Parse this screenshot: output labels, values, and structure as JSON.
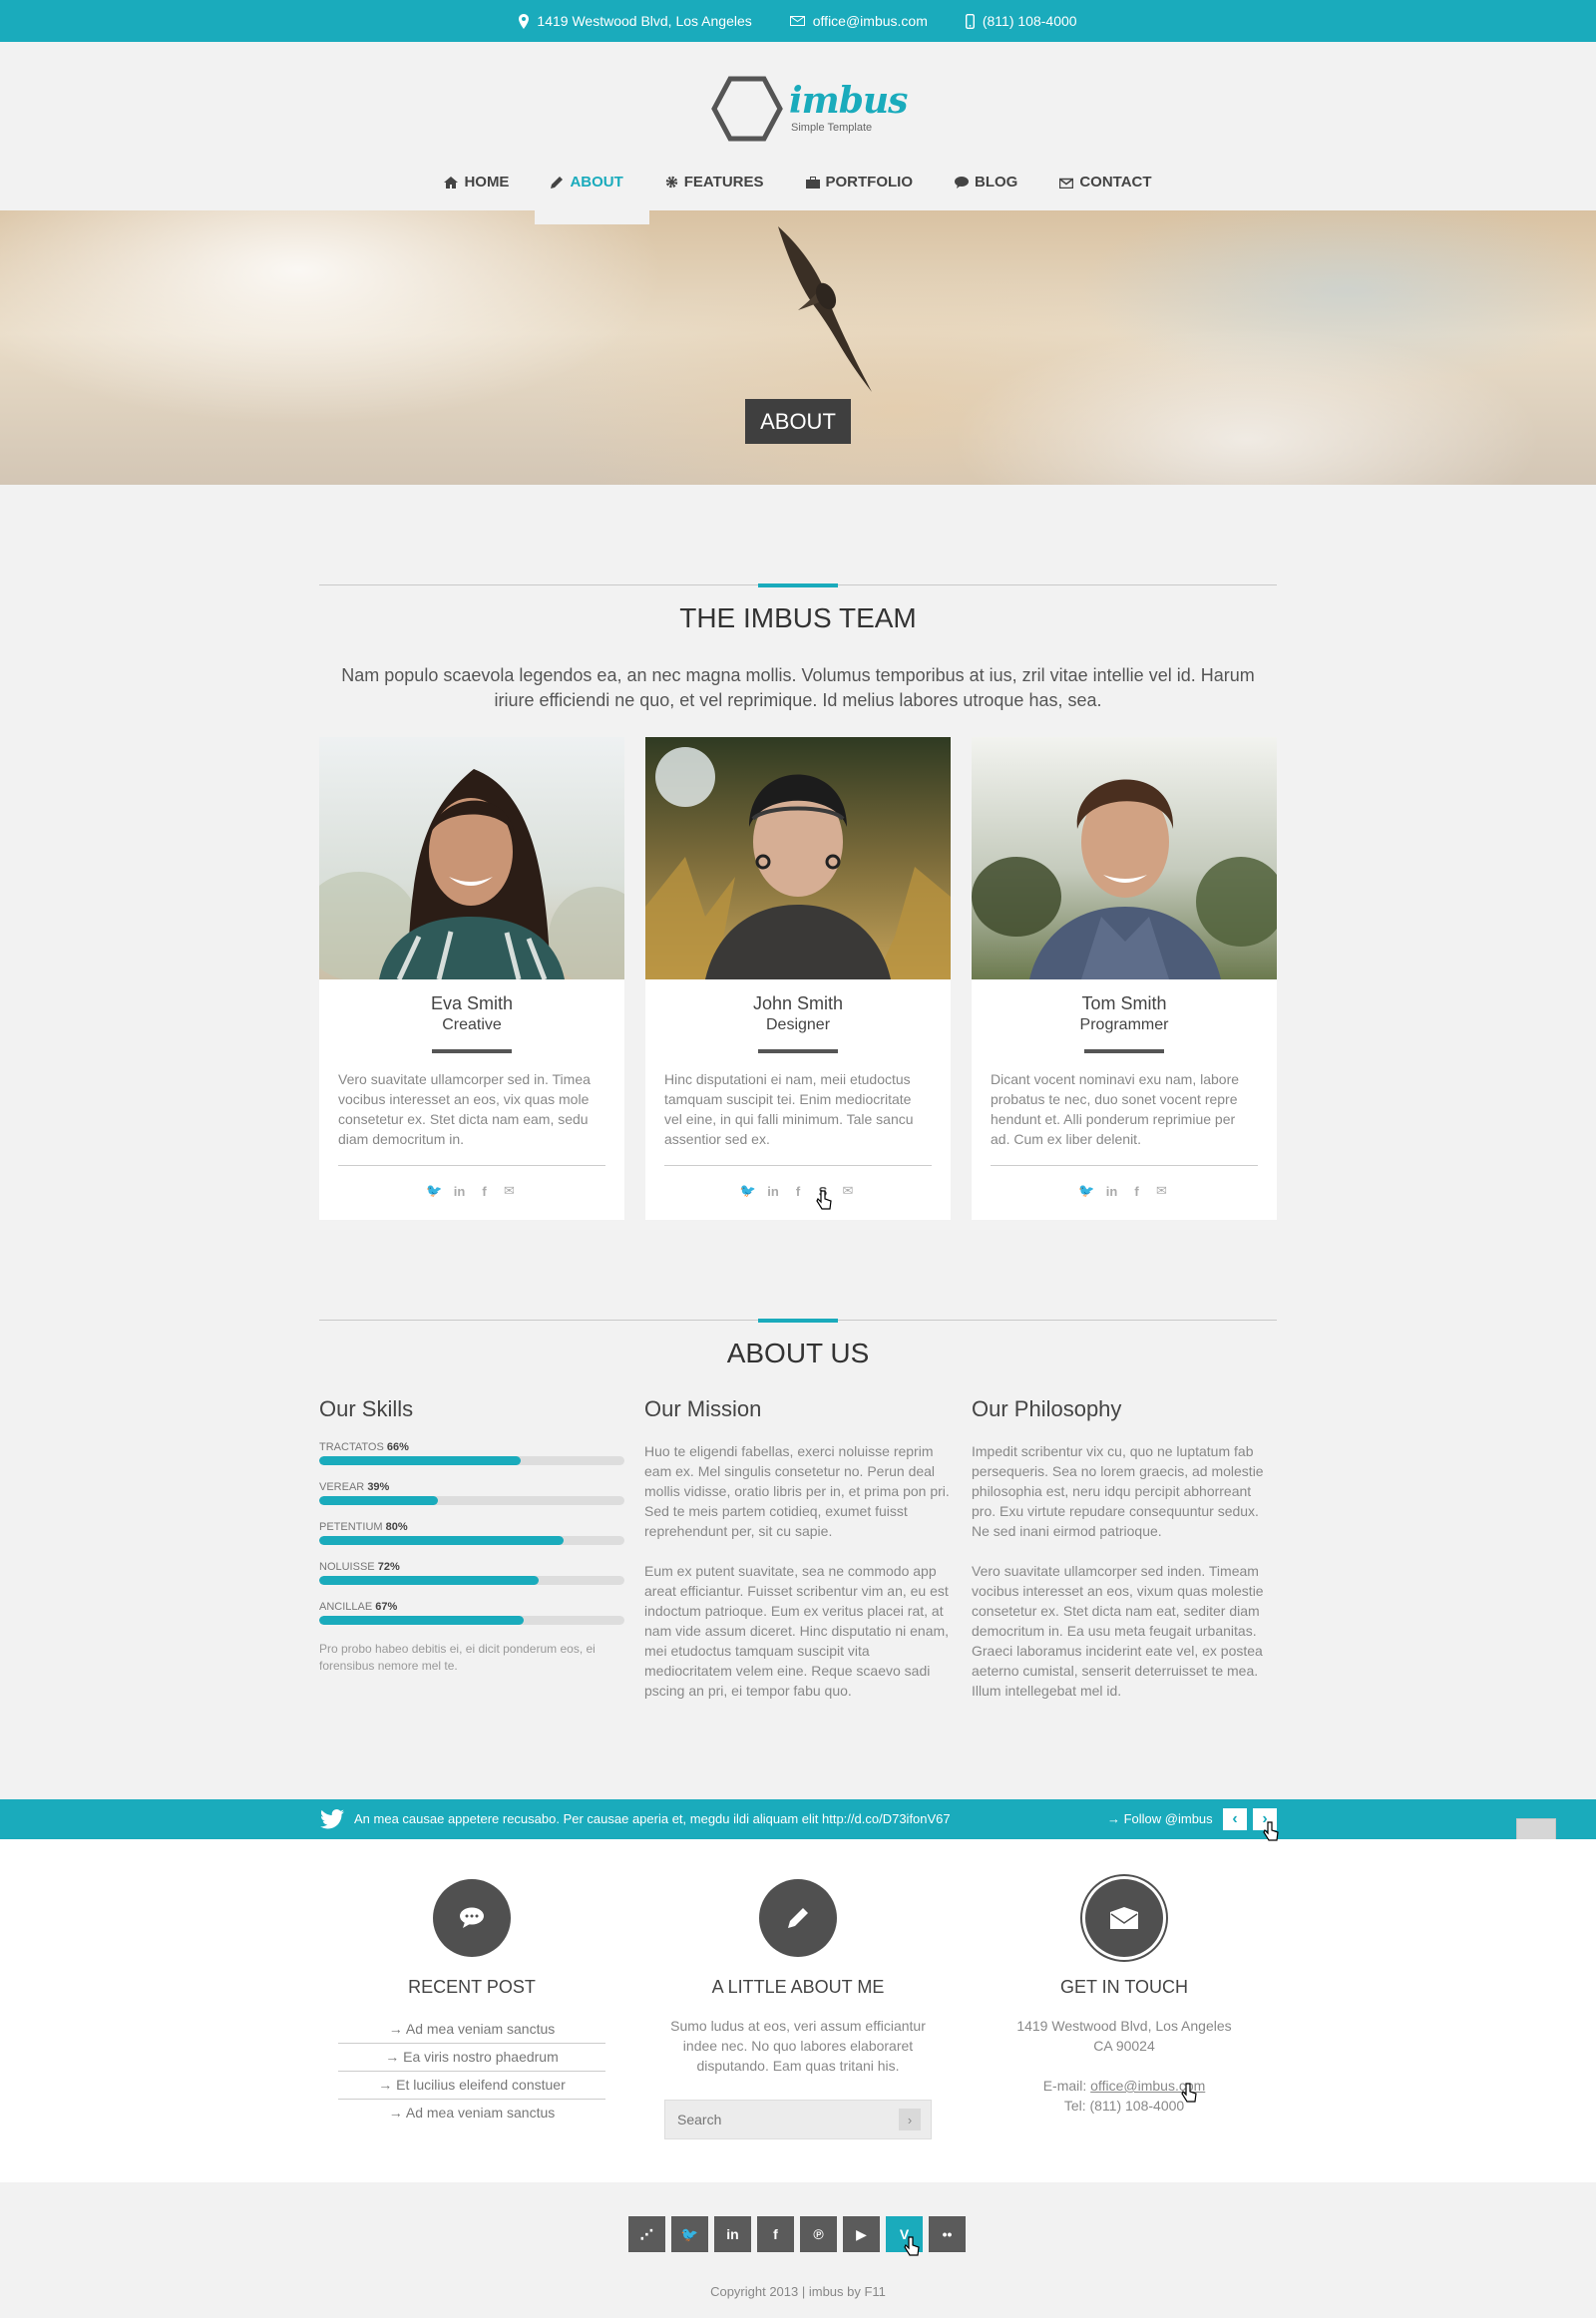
{
  "topbar": {
    "address": "1419 Westwood Blvd, Los Angeles",
    "email": "office@imbus.com",
    "phone": "(811) 108-4000"
  },
  "logo": {
    "name_part1": "im",
    "name_part2": "bus",
    "tagline": "Simple Template"
  },
  "nav": [
    {
      "label": "HOME",
      "icon": "home-icon"
    },
    {
      "label": "ABOUT",
      "icon": "pencil-icon",
      "active": true
    },
    {
      "label": "FEATURES",
      "icon": "gear-icon"
    },
    {
      "label": "PORTFOLIO",
      "icon": "briefcase-icon"
    },
    {
      "label": "BLOG",
      "icon": "chat-icon"
    },
    {
      "label": "CONTACT",
      "icon": "mail-icon"
    }
  ],
  "hero": {
    "title": "ABOUT"
  },
  "team": {
    "title": "THE IMBUS TEAM",
    "intro": "Nam populo scaevola legendos ea, an nec magna mollis. Volumus temporibus at ius, zril vitae intellie vel id. Harum iriure efficiendi ne quo, et vel reprimique. Id melius labores utroque has, sea.",
    "members": [
      {
        "name": "Eva Smith",
        "role": "Creative",
        "description": "Vero suavitate ullamcorper sed in. Timea vocibus interesset an eos, vix quas mole consetetur ex. Stet dicta nam eam, sedu diam democritum in."
      },
      {
        "name": "John Smith",
        "role": "Designer",
        "description": "Hinc disputationi ei nam, meii etudoctus tamquam suscipit tei. Enim mediocritate vel eine, in qui falli minimum. Tale sancu assentior sed ex."
      },
      {
        "name": "Tom Smith",
        "role": "Programmer",
        "description": "Dicant vocent nominavi exu nam, labore probatus te nec, duo sonet vocent repre hendunt et. Alli ponderum reprimiue per ad. Cum ex liber delenit."
      }
    ]
  },
  "about": {
    "title": "ABOUT US",
    "skills": {
      "heading": "Our Skills",
      "items": [
        {
          "label": "TRACTATOS",
          "percent_text": "66%",
          "percent": 66
        },
        {
          "label": "VEREAR",
          "percent_text": "39%",
          "percent": 39
        },
        {
          "label": "PETENTIUM",
          "percent_text": "80%",
          "percent": 80
        },
        {
          "label": "NOLUISSE",
          "percent_text": "72%",
          "percent": 72
        },
        {
          "label": "ANCILLAE",
          "percent_text": "67%",
          "percent": 67
        }
      ],
      "note": "Pro probo habeo debitis ei, ei dicit ponderum eos, ei forensibus nemore mel te."
    },
    "mission": {
      "heading": "Our Mission",
      "p1": "Huo te eligendi fabellas, exerci noluisse reprim eam ex. Mel singulis consetetur no. Perun deal mollis vidisse, oratio libris per in, et prima pon pri. Sed te meis partem cotidieq, exumet fuisst reprehendunt per, sit cu sapie.",
      "p2": "Eum ex putent suavitate, sea ne commodo app areat efficiantur. Fuisset scribentur vim an, eu est indoctum patrioque. Eum ex veritus placei rat, at nam vide assum diceret. Hinc disputatio ni enam, mei etudoctus tamquam suscipit vita mediocritatem velem eine.  Reque scaevo sadi pscing an pri, ei tempor fabu quo."
    },
    "philosophy": {
      "heading": "Our Philosophy",
      "p1": "Impedit scribentur vix cu, quo ne luptatum fab persequeris. Sea no lorem graecis, ad molestie philosophia est, neru idqu percipit abhorreant pro. Exu virtute repudare consequuntur sedux. Ne sed inani eirmod patrioque.",
      "p2": "Vero suavitate ullamcorper sed inden. Timeam vocibus interesset an eos, vixum quas molestie consetetur ex. Stet dicta nam eat, sediter diam democritum in. Ea usu meta feugait urbanitas. Graeci laboramus inciderint eate vel, ex postea aeterno cumistal, senserit deterruisset te mea. Illum intellegebat mel id."
    }
  },
  "twitter_bar": {
    "tweet": "An mea causae appetere recusabo. Per causae aperia et, megdu ildi aliquam elit http://d.co/D73ifonV67",
    "follow": "→ Follow @imbus",
    "prev": "‹",
    "next": "›"
  },
  "back_to_top": "︿",
  "footer": {
    "recent": {
      "title": "RECENT POST",
      "items": [
        "→ Ad mea veniam sanctus",
        "→ Ea viris nostro phaedrum",
        "→ Et lucilius eleifend constuer",
        "→ Ad mea veniam sanctus"
      ]
    },
    "about_me": {
      "title": "A LITTLE ABOUT ME",
      "text": "Sumo ludus at eos, veri assum efficiantur indee nec. No quo labores elaboraret disputando. Eam quas tritani his.",
      "search_placeholder": "Search",
      "search_button": "›"
    },
    "contact": {
      "title": "GET IN TOUCH",
      "address1": "1419 Westwood Blvd, Los Angeles",
      "address2": "CA 90024",
      "email_label": "E-mail:",
      "email": "office@imbus.com",
      "tel": "Tel: (811) 108-4000"
    }
  },
  "social_icons": [
    {
      "name": "rss-icon",
      "glyph": "⋰"
    },
    {
      "name": "twitter-icon",
      "glyph": "🐦"
    },
    {
      "name": "linkedin-icon",
      "glyph": "in"
    },
    {
      "name": "facebook-icon",
      "glyph": "f"
    },
    {
      "name": "pinterest-icon",
      "glyph": "℗"
    },
    {
      "name": "youtube-icon",
      "glyph": "▶"
    },
    {
      "name": "vimeo-icon",
      "glyph": "V",
      "active": true
    },
    {
      "name": "flickr-icon",
      "glyph": "••"
    }
  ],
  "copyright": "Copyright 2013 | imbus by F11",
  "colors": {
    "accent": "#1aabbc",
    "dark": "#3f3f3f",
    "page_bg": "#f2f2f2"
  }
}
